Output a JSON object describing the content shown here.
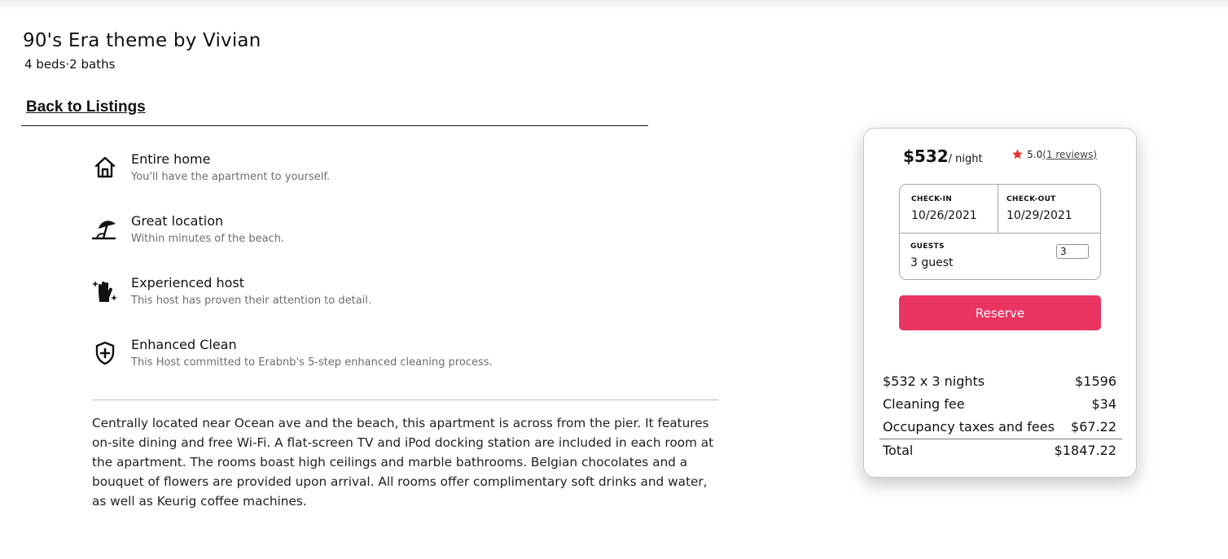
{
  "listing": {
    "title": "90's Era theme by Vivian",
    "subtitle": "4 beds·2 baths",
    "back_label": "Back to Listings"
  },
  "features": [
    {
      "icon": "home-icon",
      "name": "Entire home",
      "desc": "You'll have the apartment to yourself."
    },
    {
      "icon": "beach-umbrella-icon",
      "name": "Great location",
      "desc": "Within minutes of the beach."
    },
    {
      "icon": "sparkle-hand-icon",
      "name": "Experienced host",
      "desc": "This host has proven their attention to detail."
    },
    {
      "icon": "shield-plus-icon",
      "name": "Enhanced Clean",
      "desc": "This Host committed to Erabnb's 5-step enhanced cleaning process."
    }
  ],
  "description": "Centrally located near Ocean ave and the beach, this apartment is across from the pier. It features on-site dining and free Wi-Fi. A flat-screen TV and iPod docking station are included in each room at the apartment. The rooms boast high ceilings and marble bathrooms. Belgian chocolates and a bouquet of flowers are provided upon arrival. All rooms offer complimentary soft drinks and water, as well as Keurig coffee machines.",
  "booking": {
    "price": "$532",
    "per_night": "/ night",
    "rating": "5.0",
    "reviews": "(1 reviews)",
    "checkin_label": "CHECK-IN",
    "checkin_value": "10/26/2021",
    "checkout_label": "CHECK-OUT",
    "checkout_value": "10/29/2021",
    "guests_label": "GUESTS",
    "guests_value": "3 guest",
    "guests_input": "3",
    "reserve_label": "Reserve",
    "lines": [
      {
        "label": "$532 x 3 nights",
        "amount": "$1596"
      },
      {
        "label": "Cleaning fee",
        "amount": "$34"
      },
      {
        "label": "Occupancy taxes and fees",
        "amount": "$67.22"
      }
    ],
    "total_label": "Total",
    "total_amount": "$1847.22"
  },
  "colors": {
    "accent": "#ea3461",
    "star": "#e8322e"
  }
}
